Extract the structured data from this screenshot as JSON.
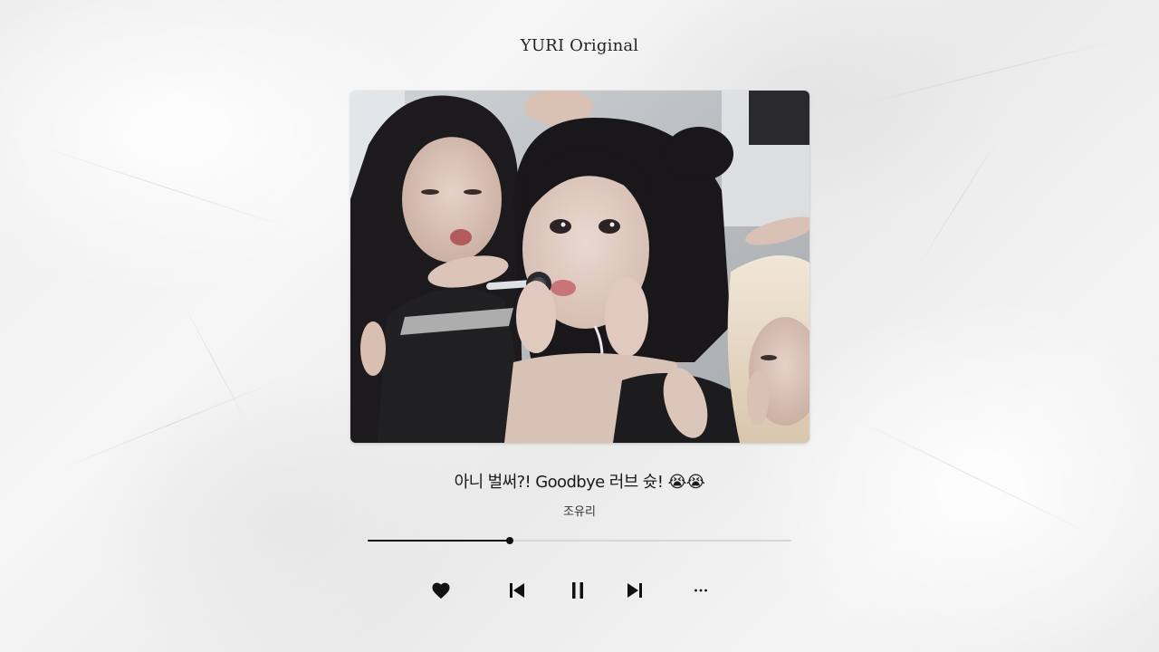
{
  "brand": "YURI Original",
  "cover": {
    "image": "album-cover-photo"
  },
  "track": {
    "title": "아니 벌써?! Goodbye 러브 슛! 😭😭",
    "artist": "조유리",
    "progress": 0.335
  },
  "controls": {
    "like": "heart-icon",
    "previous": "skip-previous-icon",
    "pause": "pause-icon",
    "next": "skip-next-icon",
    "more": "more-icon"
  },
  "colors": {
    "accent": "#111111",
    "track_bg": "#d6d6d6",
    "page_bg": "#efefef"
  }
}
